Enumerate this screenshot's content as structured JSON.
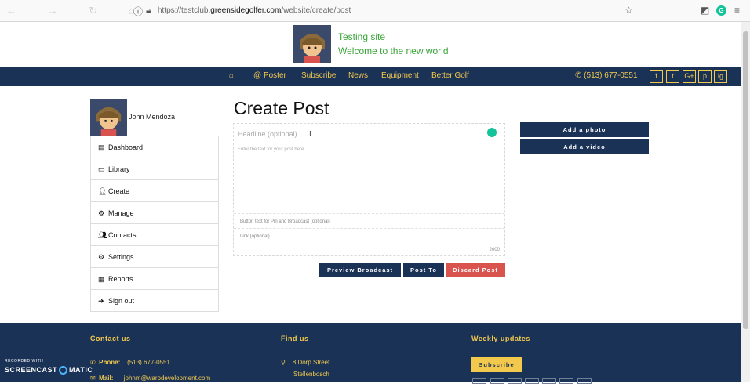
{
  "browser": {
    "url_prefix": "https://testclub.",
    "url_domain": "greensidegolfer.com",
    "url_path": "/website/create/post"
  },
  "site": {
    "title": "Testing site",
    "subtitle": "Welcome to the new world"
  },
  "nav": {
    "home_icon": "home-icon",
    "items": [
      "Poster",
      "Subscribe",
      "News",
      "Equipment",
      "Better Golf"
    ],
    "phone": "(513) 677-0551",
    "social": [
      "f",
      "t",
      "G+",
      "p",
      "ig"
    ]
  },
  "profile": {
    "name": "John Mendoza"
  },
  "sidebar": {
    "items": [
      {
        "label": "Dashboard",
        "icon": "dashboard-icon"
      },
      {
        "label": "Library",
        "icon": "monitor-icon"
      },
      {
        "label": "Create",
        "icon": "user-icon"
      },
      {
        "label": "Manage",
        "icon": "users-cog-icon"
      },
      {
        "label": "Contacts",
        "icon": "users-icon"
      },
      {
        "label": "Settings",
        "icon": "gears-icon"
      },
      {
        "label": "Reports",
        "icon": "report-icon"
      },
      {
        "label": "Sign out",
        "icon": "sign-out-icon"
      }
    ]
  },
  "main": {
    "title": "Create Post",
    "headline_placeholder": "Headline (optional)",
    "body_placeholder": "Enter the text for your post here...",
    "button_text_placeholder": "Button text for Pin and Broadcast (optional)",
    "link_placeholder": "Link (optional)",
    "char_count": "2000",
    "buttons": {
      "preview": "Preview Broadcast",
      "post": "Post To",
      "discard": "Discard Post",
      "add_photo": "Add a photo",
      "add_video": "Add a video"
    }
  },
  "footer": {
    "contact_heading": "Contact us",
    "phone_label": "Phone:",
    "phone": "(513) 677-0551",
    "mail_label": "Mail:",
    "mail": "johnm@warpdevelopment.com",
    "find_heading": "Find us",
    "address_line1": "8 Dorp Street",
    "address_line2": "Stellenbosch",
    "weekly_heading": "Weekly updates",
    "subscribe": "Subscribe"
  },
  "watermark": {
    "recorded": "RECORDED WITH",
    "brand_left": "SCREENCAST",
    "brand_right": "MATIC"
  },
  "colors": {
    "navy": "#1b3257",
    "gold": "#f2c94c",
    "green": "#3aa33a",
    "red": "#d9534f"
  }
}
